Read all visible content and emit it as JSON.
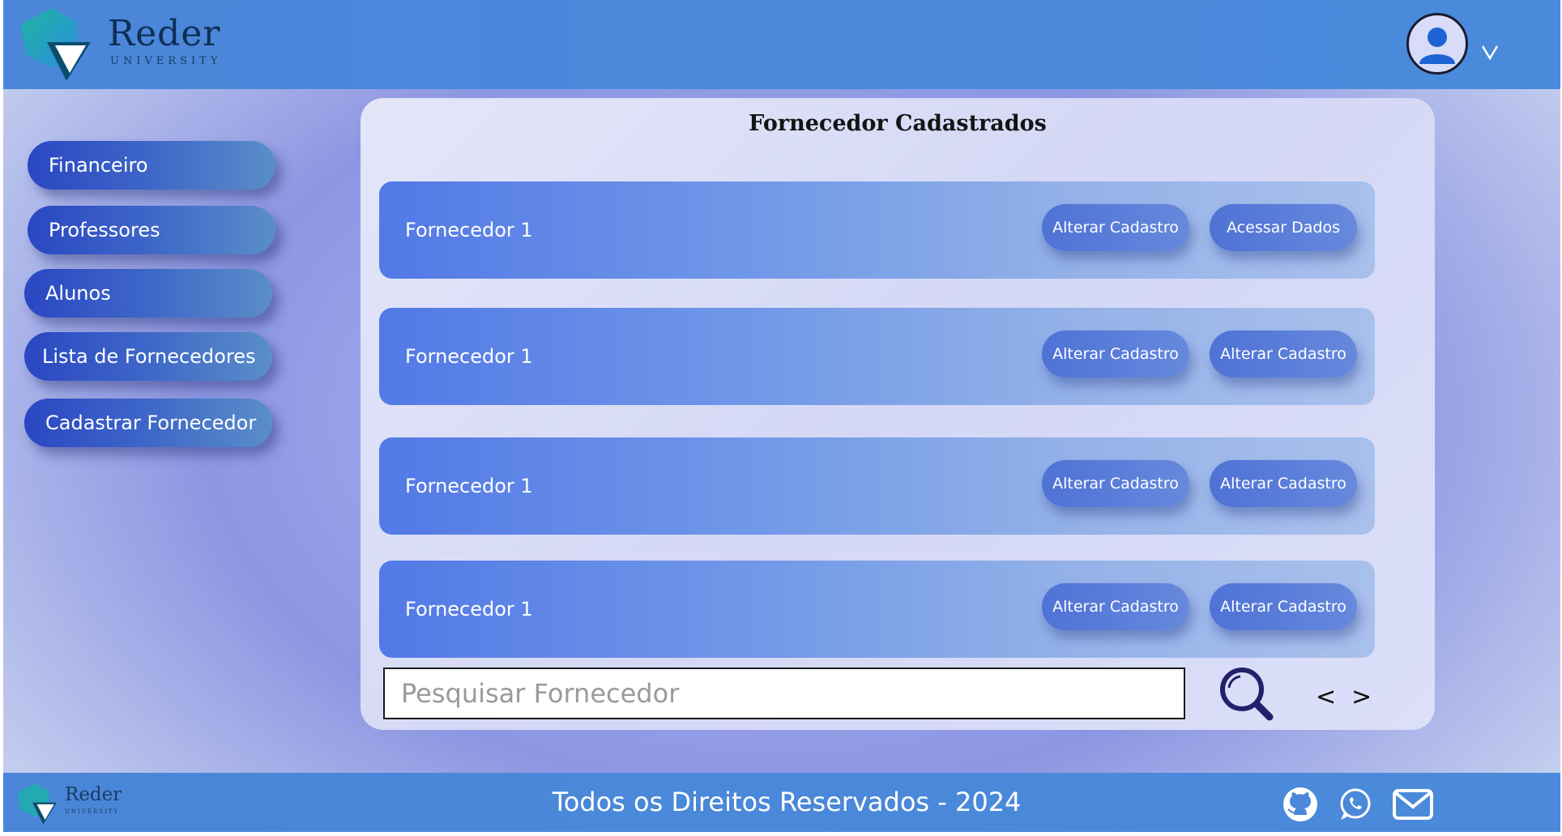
{
  "brand": {
    "name": "Reder",
    "subtitle": "UNIVERSITY"
  },
  "colors": {
    "header": "#4a88da",
    "accent": "#2a47c2",
    "row": "#5279e6"
  },
  "sidebar": {
    "items": [
      {
        "label": "Financeiro"
      },
      {
        "label": "Professores"
      },
      {
        "label": "Alunos"
      },
      {
        "label": "Lista de Fornecedores"
      },
      {
        "label": "Cadastrar Fornecedor"
      }
    ]
  },
  "main": {
    "title": "Fornecedor Cadastrados",
    "rows": [
      {
        "name": "Fornecedor 1",
        "action1": "Alterar Cadastro",
        "action2": "Acessar Dados"
      },
      {
        "name": "Fornecedor 1",
        "action1": "Alterar Cadastro",
        "action2": "Alterar Cadastro"
      },
      {
        "name": "Fornecedor 1",
        "action1": "Alterar Cadastro",
        "action2": "Alterar Cadastro"
      },
      {
        "name": "Fornecedor 1",
        "action1": "Alterar Cadastro",
        "action2": "Alterar Cadastro"
      }
    ],
    "search": {
      "placeholder": "Pesquisar Fornecedor",
      "value": ""
    },
    "pager": {
      "prev": "<",
      "next": ">"
    }
  },
  "header": {
    "user_icon": "user-avatar-icon",
    "menu_icon": "chevron-down-icon"
  },
  "footer": {
    "text": "Todos os Direitos Reservados - 2024",
    "icons": [
      "github-icon",
      "whatsapp-icon",
      "mail-icon"
    ]
  }
}
